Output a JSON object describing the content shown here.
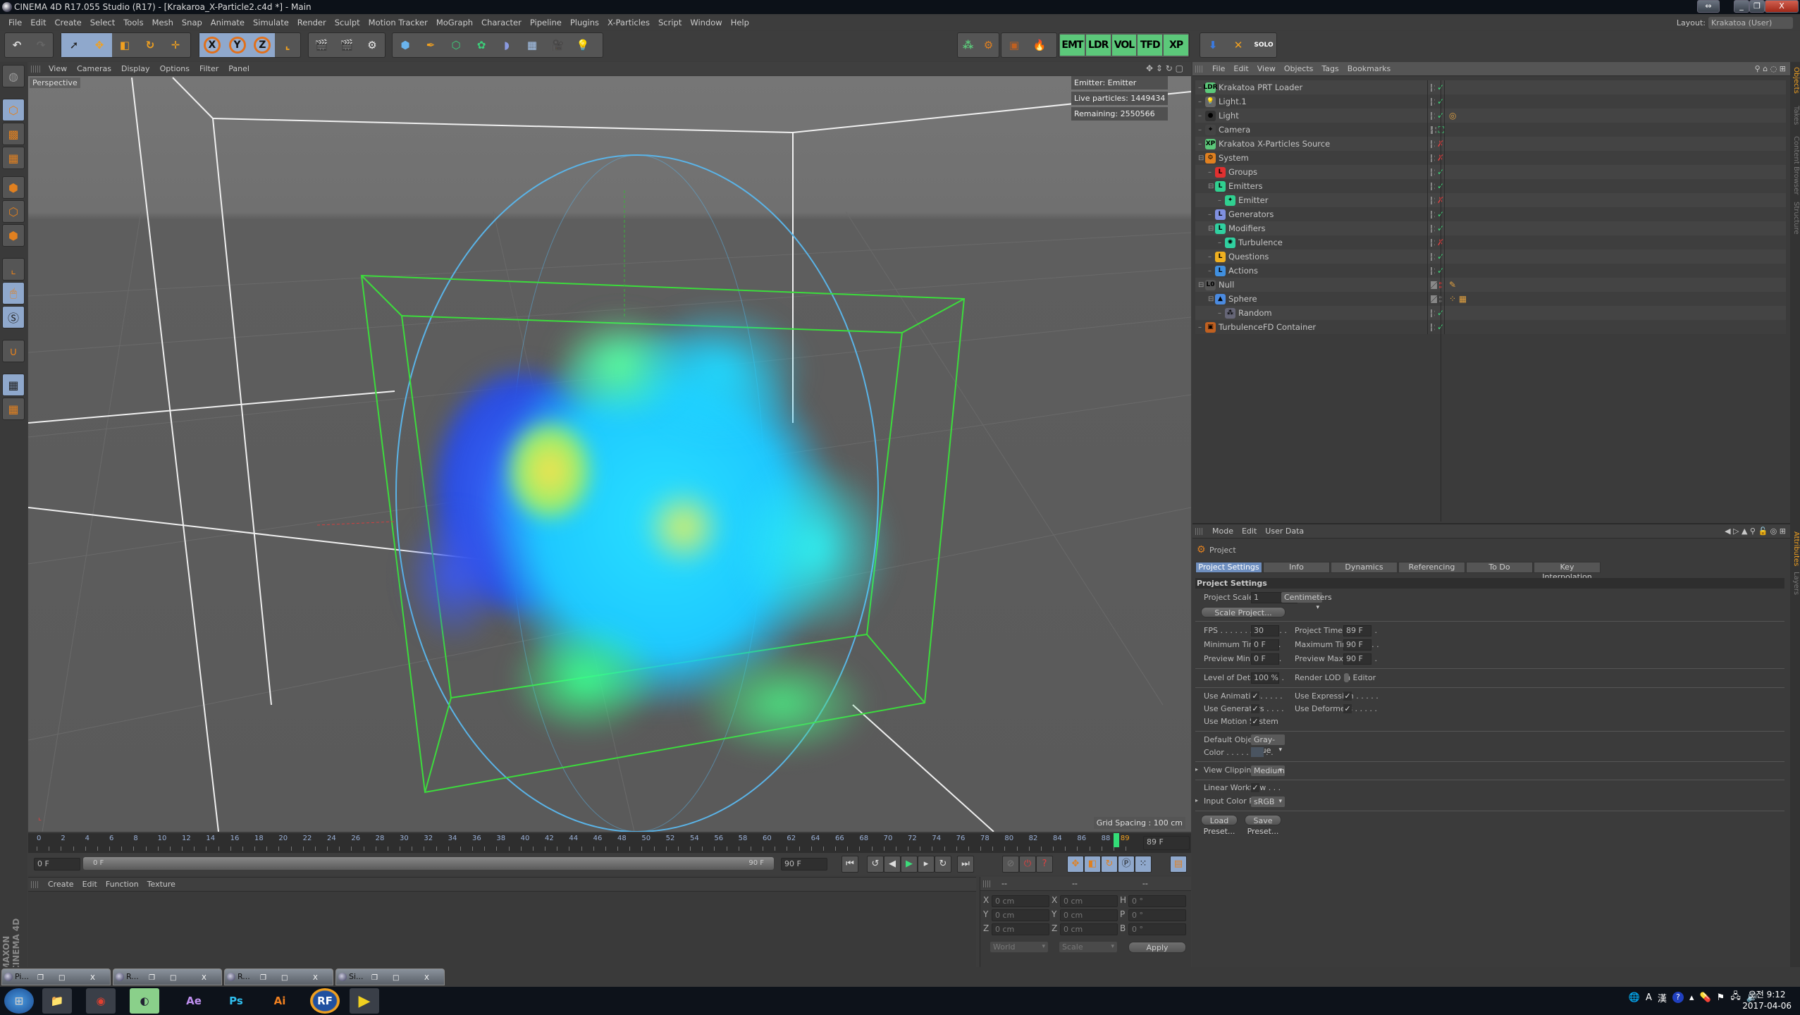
{
  "window": {
    "title": "CINEMA 4D R17.055 Studio (R17) - [Krakaroa_X-Particle2.c4d *] - Main",
    "controls": [
      "⇔",
      "_",
      "❐",
      "X"
    ]
  },
  "menu": [
    "File",
    "Edit",
    "Create",
    "Select",
    "Tools",
    "Mesh",
    "Snap",
    "Animate",
    "Simulate",
    "Render",
    "Sculpt",
    "Motion Tracker",
    "MoGraph",
    "Character",
    "Pipeline",
    "Plugins",
    "X-Particles",
    "Script",
    "Window",
    "Help"
  ],
  "layout": {
    "label": "Layout:",
    "value": "Krakatoa (User)"
  },
  "toolbar": {
    "axis": [
      "X",
      "Y",
      "Z"
    ],
    "krakatoa": [
      "EMT",
      "LDR",
      "VOL",
      "TFD",
      "XP"
    ],
    "solo": "SOLO"
  },
  "viewport": {
    "menu": [
      "View",
      "Cameras",
      "Display",
      "Options",
      "Filter",
      "Panel"
    ],
    "label": "Perspective",
    "hud": [
      "Emitter: Emitter",
      "Live particles: 1449434",
      "Remaining: 2550566"
    ],
    "grid_spacing": "Grid Spacing : 100 cm"
  },
  "colors": {
    "accent": "#8fa8cc",
    "particles": [
      "#1ec8ff",
      "#2a6cff",
      "#3cff8c",
      "#ffe04a"
    ],
    "bbox": "#3cdc3c",
    "sphere": "#5ab4e8"
  },
  "timeline": {
    "ruler_labels": [
      0,
      2,
      4,
      6,
      8,
      10,
      12,
      14,
      16,
      18,
      20,
      22,
      24,
      26,
      28,
      30,
      32,
      34,
      36,
      38,
      40,
      42,
      44,
      46,
      48,
      50,
      52,
      54,
      56,
      58,
      60,
      62,
      64,
      66,
      68,
      70,
      72,
      74,
      76,
      78,
      80,
      82,
      84,
      86,
      88
    ],
    "current_marker": "89",
    "max_frame": 90,
    "current_field": "89 F",
    "start_field": "0 F",
    "slider_start": "0 F",
    "slider_end": "90 F",
    "end_field": "90 F"
  },
  "material_manager": {
    "menu": [
      "Create",
      "Edit",
      "Function",
      "Texture"
    ]
  },
  "coords": {
    "headers": [
      "--",
      "--",
      "--"
    ],
    "rows": [
      [
        "X",
        "0 cm",
        "X",
        "0 cm",
        "H",
        "0 °"
      ],
      [
        "Y",
        "0 cm",
        "Y",
        "0 cm",
        "P",
        "0 °"
      ],
      [
        "Z",
        "0 cm",
        "Z",
        "0 cm",
        "B",
        "0 °"
      ]
    ],
    "mode1": "World",
    "mode2": "Scale",
    "apply": "Apply"
  },
  "object_manager": {
    "menu": [
      "File",
      "Edit",
      "View",
      "Objects",
      "Tags",
      "Bookmarks"
    ],
    "objects": [
      {
        "name": "Krakatoa PRT Loader",
        "depth": 0,
        "icon": "LDR",
        "color": "#5cc87a",
        "status": "✓",
        "tags": ""
      },
      {
        "name": "Light.1",
        "depth": 0,
        "icon": "💡",
        "color": "#666",
        "status": "✓",
        "tags": ""
      },
      {
        "name": "Light",
        "depth": 0,
        "icon": "●",
        "color": "#333",
        "status": "✓",
        "tags": "◎"
      },
      {
        "name": "Camera",
        "depth": 0,
        "icon": "⌖",
        "color": "#444",
        "status": "⛶",
        "tags": ""
      },
      {
        "name": "Krakatoa X-Particles Source",
        "depth": 0,
        "icon": "XP",
        "color": "#5cc87a",
        "status": "✗",
        "tags": ""
      },
      {
        "name": "System",
        "depth": 0,
        "icon": "⚙",
        "color": "#e08020",
        "status": "✗",
        "tags": "",
        "expand": "⊟"
      },
      {
        "name": "Groups",
        "depth": 1,
        "icon": "L",
        "color": "#e03030",
        "status": "✓",
        "tags": ""
      },
      {
        "name": "Emitters",
        "depth": 1,
        "icon": "L",
        "color": "#30d090",
        "status": "✓",
        "tags": "",
        "expand": "⊟"
      },
      {
        "name": "Emitter",
        "depth": 2,
        "icon": "✦",
        "color": "#30d090",
        "status": "✗",
        "tags": ""
      },
      {
        "name": "Generators",
        "depth": 1,
        "icon": "L",
        "color": "#8090e0",
        "status": "✓",
        "tags": ""
      },
      {
        "name": "Modifiers",
        "depth": 1,
        "icon": "L",
        "color": "#30d0a0",
        "status": "✓",
        "tags": "",
        "expand": "⊟"
      },
      {
        "name": "Turbulence",
        "depth": 2,
        "icon": "✺",
        "color": "#30d0a0",
        "status": "✗",
        "tags": ""
      },
      {
        "name": "Questions",
        "depth": 1,
        "icon": "L",
        "color": "#f0b020",
        "status": "✓",
        "tags": ""
      },
      {
        "name": "Actions",
        "depth": 1,
        "icon": "L",
        "color": "#4090e0",
        "status": "✓",
        "tags": ""
      },
      {
        "name": "Null",
        "depth": 0,
        "icon": "L0",
        "color": "#555",
        "status": "",
        "tags": "✎",
        "expand": "⊟",
        "dots": "red"
      },
      {
        "name": "Sphere",
        "depth": 1,
        "icon": "▲",
        "color": "#4a8ae0",
        "status": "",
        "tags": "⁘ ▦",
        "expand": "⊟"
      },
      {
        "name": "Random",
        "depth": 2,
        "icon": "⁂",
        "color": "#667",
        "status": "✓",
        "tags": ""
      },
      {
        "name": "TurbulenceFD Container",
        "depth": 0,
        "icon": "▣",
        "color": "#c06020",
        "status": "✓",
        "tags": ""
      }
    ]
  },
  "side_tabs": [
    "Objects",
    "Takes",
    "Content Browser",
    "Structure",
    "Attributes",
    "Layers"
  ],
  "attributes": {
    "menu": [
      "Mode",
      "Edit",
      "User Data"
    ],
    "object": "Project",
    "tabs": [
      "Project Settings",
      "Info",
      "Dynamics",
      "Referencing",
      "To Do",
      "Key Interpolation"
    ],
    "section": "Project Settings",
    "project_scale": {
      "label": "Project Scale . . . . . .",
      "value": "1",
      "unit": "Centimeters"
    },
    "scale_project": "Scale Project...",
    "fps": {
      "label": "FPS . . . . . . . . . . . . . .",
      "value": "30"
    },
    "project_time": {
      "label": "Project Time . . . . . . .",
      "value": "89 F"
    },
    "min_time": {
      "label": "Minimum Time . . . .",
      "value": "0 F"
    },
    "max_time": {
      "label": "Maximum Time . . . . .",
      "value": "90 F"
    },
    "prev_min": {
      "label": "Preview Min Time . .",
      "value": "0 F"
    },
    "prev_max": {
      "label": "Preview Max Time. . .",
      "value": "90 F"
    },
    "lod": {
      "label": "Level of Detail . . . . .",
      "value": "100 %"
    },
    "render_lod": {
      "label": "Render LOD in Editor",
      "checked": false
    },
    "use_animation": {
      "label": "Use Animation. . . . .",
      "checked": true
    },
    "use_expression": {
      "label": "Use Expression . . . . .",
      "checked": true
    },
    "use_generators": {
      "label": "Use Generators . . . .",
      "checked": true
    },
    "use_deformers": {
      "label": "Use Deformers . . . . .",
      "checked": true
    },
    "use_motion": {
      "label": "Use Motion System",
      "checked": true
    },
    "default_color": {
      "label": "Default Object Color",
      "value": "Gray-Blue"
    },
    "color": {
      "label": "Color . . . . . . . . . .",
      "swatch": "#4a5460"
    },
    "view_clipping": {
      "label": "View Clipping . . . . .",
      "value": "Medium"
    },
    "linear_workflow": {
      "label": "Linear Workflow . . .",
      "checked": true
    },
    "input_profile": {
      "label": "Input Color Profile .",
      "value": "sRGB"
    },
    "load_preset": "Load Preset...",
    "save_preset": "Save Preset..."
  },
  "minimized_windows": [
    "Pi...",
    "R...",
    "R...",
    "Si..."
  ],
  "taskbar": {
    "apps": [
      "start",
      "explorer",
      "chrome",
      "cinema4d",
      "Ae",
      "Ps",
      "Ai",
      "RF",
      "player"
    ],
    "tray": [
      "A",
      "漢",
      "?"
    ],
    "time": "오전 9:12",
    "date": "2017-04-06"
  }
}
